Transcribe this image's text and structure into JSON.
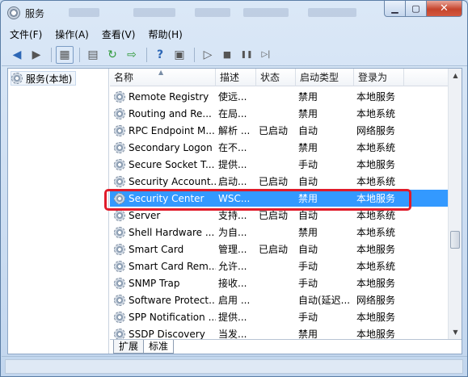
{
  "window": {
    "title": "服务"
  },
  "menu": [
    {
      "label": "文件(F)"
    },
    {
      "label": "操作(A)"
    },
    {
      "label": "查看(V)"
    },
    {
      "label": "帮助(H)"
    }
  ],
  "toolbar": [
    {
      "icon": "back-arrow-icon",
      "glyph": "◀"
    },
    {
      "icon": "forward-arrow-icon",
      "glyph": "▶"
    },
    {
      "icon": "console-tree-icon",
      "glyph": "▦"
    },
    {
      "icon": "properties-icon",
      "glyph": "▤"
    },
    {
      "icon": "refresh-icon",
      "glyph": "↻"
    },
    {
      "icon": "export-list-icon",
      "glyph": "⇨"
    },
    {
      "icon": "help-icon",
      "glyph": "?"
    },
    {
      "icon": "show-hide-icon",
      "glyph": "▣"
    },
    {
      "icon": "start-service-icon",
      "glyph": "▷"
    },
    {
      "icon": "stop-service-icon",
      "glyph": "■"
    },
    {
      "icon": "pause-service-icon",
      "glyph": "❚❚"
    },
    {
      "icon": "restart-service-icon",
      "glyph": "▷|"
    }
  ],
  "tree": {
    "label": "服务(本地)"
  },
  "columns": {
    "name": "名称",
    "desc": "描述",
    "status": "状态",
    "startup": "启动类型",
    "logon": "登录为"
  },
  "services": [
    {
      "name": "Remote Registry",
      "desc": "使远...",
      "status": "",
      "startup": "禁用",
      "logon": "本地服务"
    },
    {
      "name": "Routing and Re...",
      "desc": "在局...",
      "status": "",
      "startup": "禁用",
      "logon": "本地系统"
    },
    {
      "name": "RPC Endpoint M...",
      "desc": "解析 ...",
      "status": "已启动",
      "startup": "自动",
      "logon": "网络服务"
    },
    {
      "name": "Secondary Logon",
      "desc": "在不...",
      "status": "",
      "startup": "禁用",
      "logon": "本地系统"
    },
    {
      "name": "Secure Socket T...",
      "desc": "提供...",
      "status": "",
      "startup": "手动",
      "logon": "本地服务"
    },
    {
      "name": "Security Account...",
      "desc": "启动...",
      "status": "已启动",
      "startup": "自动",
      "logon": "本地系统"
    },
    {
      "name": "Security Center",
      "desc": "WSC...",
      "status": "",
      "startup": "禁用",
      "logon": "本地服务"
    },
    {
      "name": "Server",
      "desc": "支持...",
      "status": "已启动",
      "startup": "自动",
      "logon": "本地系统"
    },
    {
      "name": "Shell Hardware ...",
      "desc": "为自...",
      "status": "",
      "startup": "禁用",
      "logon": "本地系统"
    },
    {
      "name": "Smart Card",
      "desc": "管理...",
      "status": "已启动",
      "startup": "自动",
      "logon": "本地服务"
    },
    {
      "name": "Smart Card Rem...",
      "desc": "允许...",
      "status": "",
      "startup": "手动",
      "logon": "本地系统"
    },
    {
      "name": "SNMP Trap",
      "desc": "接收...",
      "status": "",
      "startup": "手动",
      "logon": "本地服务"
    },
    {
      "name": "Software Protect...",
      "desc": "启用 ...",
      "status": "",
      "startup": "自动(延迟...",
      "logon": "网络服务"
    },
    {
      "name": "SPP Notification ...",
      "desc": "提供...",
      "status": "",
      "startup": "手动",
      "logon": "本地服务"
    },
    {
      "name": "SSDP Discovery",
      "desc": "当发...",
      "status": "",
      "startup": "禁用",
      "logon": "本地服务"
    }
  ],
  "selected_index": 6,
  "tabs": [
    {
      "label": "扩展"
    },
    {
      "label": "标准"
    }
  ],
  "active_tab": 1
}
